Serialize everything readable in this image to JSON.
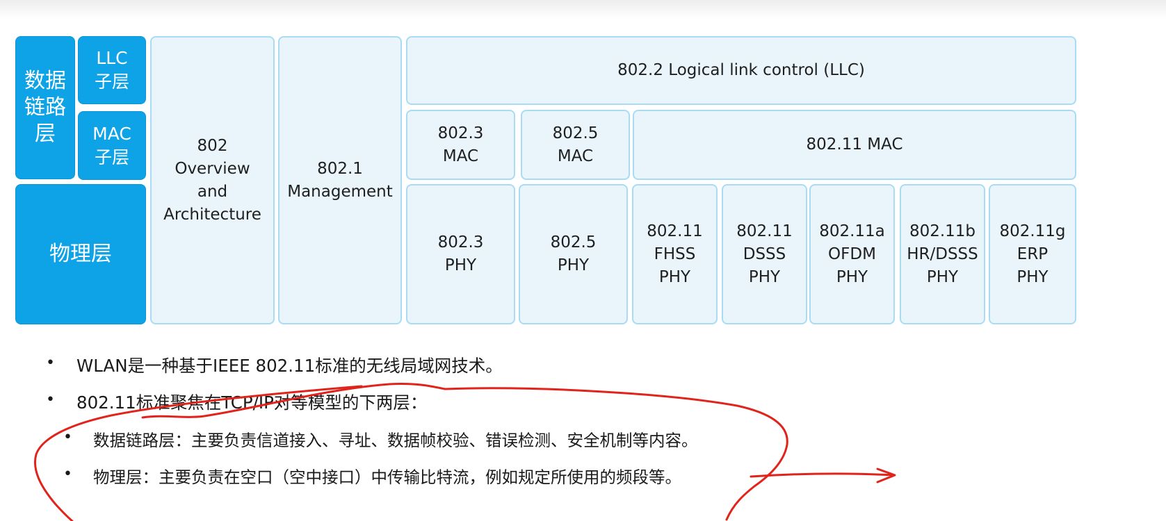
{
  "diagram": {
    "datalink_layer_label": "数据\n链路\n层",
    "llc_sublayer_label": "LLC\n子层",
    "mac_sublayer_label": "MAC\n子层",
    "physical_layer_label": "物理层",
    "overview_label": "802\nOverview\nand\nArchitecture",
    "management_label": "802.1\nManagement",
    "llc_label": "802.2 Logical link control (LLC)",
    "mac_802_3_label": "802.3\nMAC",
    "mac_802_5_label": "802.5\nMAC",
    "mac_802_11_label": "802.11 MAC",
    "phy_802_3_label": "802.3\nPHY",
    "phy_802_5_label": "802.5\nPHY",
    "phy_fhss_label": "802.11\nFHSS\nPHY",
    "phy_dsss_label": "802.11\nDSSS\nPHY",
    "phy_ofdm_label": "802.11a\nOFDM\nPHY",
    "phy_hrdsss_label": "802.11b\nHR/DSSS\nPHY",
    "phy_erp_label": "802.11g\nERP\nPHY"
  },
  "bullets": {
    "item1": "WLAN是一种基于IEEE 802.11标准的无线局域网技术。",
    "item2": "802.11标准聚焦在TCP/IP对等模型的下两层：",
    "sub1": "数据链路层：主要负责信道接入、寻址、数据帧校验、错误检测、安全机制等内容。",
    "sub2": "物理层：主要负责在空口（空中接口）中传输比特流，例如规定所使用的频段等。",
    "bullet_char": "•"
  },
  "colors": {
    "dark_fill": "#0ea2e6",
    "light_fill": "#eaf5fb",
    "light_border": "#a9dbf4",
    "annotation_ink": "#e0241c"
  }
}
